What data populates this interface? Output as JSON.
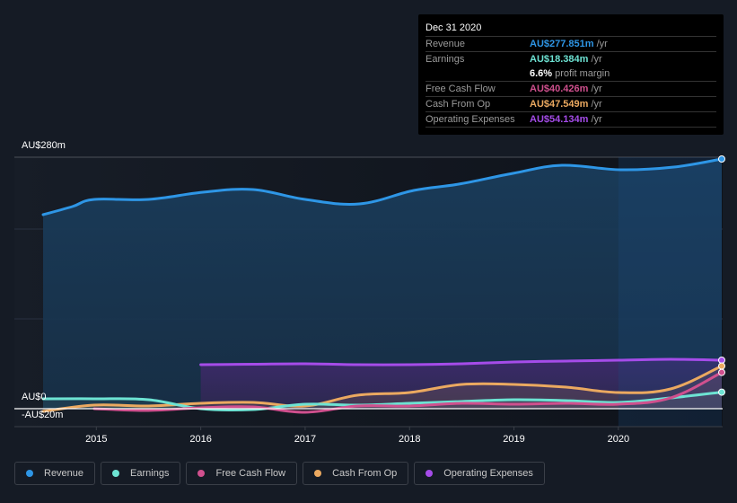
{
  "tooltip": {
    "date": "Dec 31 2020",
    "rows": [
      {
        "label": "Revenue",
        "value": "AU$277.851m",
        "unit": "/yr",
        "color": "#2e96e6"
      },
      {
        "label": "Earnings",
        "value": "AU$18.384m",
        "unit": "/yr",
        "color": "#6de3d3"
      },
      {
        "label": "",
        "value": "6.6%",
        "unit": "profit margin",
        "color": "#ffffff"
      },
      {
        "label": "Free Cash Flow",
        "value": "AU$40.426m",
        "unit": "/yr",
        "color": "#d0508e"
      },
      {
        "label": "Cash From Op",
        "value": "AU$47.549m",
        "unit": "/yr",
        "color": "#eba960"
      },
      {
        "label": "Operating Expenses",
        "value": "AU$54.134m",
        "unit": "/yr",
        "color": "#a54ce9"
      }
    ]
  },
  "legend": [
    {
      "label": "Revenue",
      "color": "#2e96e6"
    },
    {
      "label": "Earnings",
      "color": "#6de3d3"
    },
    {
      "label": "Free Cash Flow",
      "color": "#d0508e"
    },
    {
      "label": "Cash From Op",
      "color": "#eba960"
    },
    {
      "label": "Operating Expenses",
      "color": "#a54ce9"
    }
  ],
  "chart_data": {
    "type": "area",
    "title": "",
    "xlabel": "",
    "ylabel": "",
    "y_tick_labels": [
      "AU$280m",
      "AU$0",
      "-AU$20m"
    ],
    "y_ticks": [
      280,
      0,
      -20
    ],
    "ylim": [
      -20,
      280
    ],
    "xlim": [
      2014.49,
      2020.99
    ],
    "x_tick_labels": [
      "2015",
      "2016",
      "2017",
      "2018",
      "2019",
      "2020"
    ],
    "x_ticks": [
      2015,
      2016,
      2017,
      2018,
      2019,
      2020
    ],
    "highlight_from": 2020.0,
    "grid": true,
    "series": [
      {
        "name": "Revenue",
        "color": "#2e96e6",
        "x": [
          2014.49,
          2014.77,
          2014.98,
          2015.5,
          2016.02,
          2016.5,
          2017.0,
          2017.52,
          2018.04,
          2018.47,
          2018.99,
          2019.46,
          2020.02,
          2020.53,
          2020.99
        ],
        "values": [
          216,
          225,
          233,
          233,
          241,
          244,
          233,
          228,
          243,
          250,
          262,
          271,
          266,
          269,
          278
        ]
      },
      {
        "name": "Operating Expenses",
        "color": "#a54ce9",
        "x": [
          2016.0,
          2016.5,
          2017.0,
          2017.5,
          2018.0,
          2018.5,
          2019.0,
          2019.5,
          2020.0,
          2020.5,
          2020.99
        ],
        "values": [
          49,
          49.5,
          50,
          49,
          49,
          50,
          52,
          53,
          54,
          55,
          54
        ]
      },
      {
        "name": "Cash From Op",
        "color": "#eba960",
        "x": [
          2014.49,
          2014.98,
          2015.5,
          2016.0,
          2016.5,
          2017.0,
          2017.5,
          2018.0,
          2018.5,
          2019.0,
          2019.5,
          2020.0,
          2020.5,
          2020.99
        ],
        "values": [
          -3,
          4,
          3,
          6,
          7,
          3,
          15,
          18,
          27,
          27,
          24,
          18,
          22,
          47.5
        ]
      },
      {
        "name": "Earnings",
        "color": "#6de3d3",
        "x": [
          2014.49,
          2014.98,
          2015.5,
          2016.0,
          2016.5,
          2017.0,
          2017.5,
          2018.0,
          2018.5,
          2019.0,
          2019.5,
          2020.0,
          2020.5,
          2020.99
        ],
        "values": [
          11,
          11,
          10,
          0,
          -1,
          5,
          4,
          6,
          8,
          10,
          9,
          7,
          12,
          18.4
        ]
      },
      {
        "name": "Free Cash Flow",
        "color": "#d0508e",
        "x": [
          2014.98,
          2015.5,
          2016.0,
          2016.5,
          2017.0,
          2017.5,
          2018.0,
          2018.5,
          2019.0,
          2019.5,
          2020.0,
          2020.5,
          2020.99
        ],
        "values": [
          0,
          -2,
          1,
          2,
          -4,
          3,
          3,
          6,
          5,
          6,
          5,
          12,
          40.4
        ]
      }
    ]
  }
}
